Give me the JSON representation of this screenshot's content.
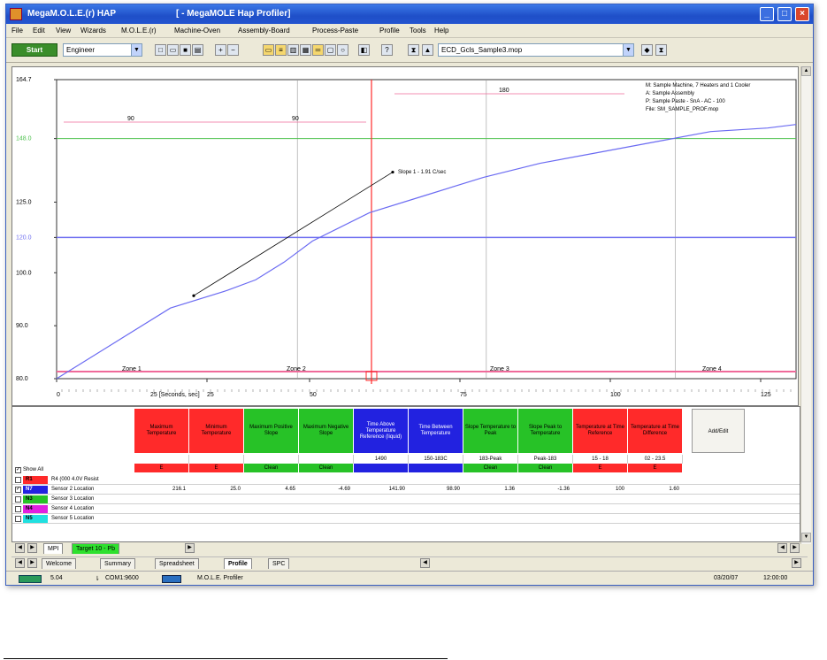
{
  "titlebar": {
    "app_title": "MegaM.O.L.E.(r) HAP",
    "doc_title": "[ - MegaMOLE Hap Profiler]"
  },
  "menu": [
    "File",
    "Edit",
    "View",
    "Wizards",
    "M.O.L.E.(r)",
    "Machine-Oven",
    "Assembly-Board",
    "Process-Paste",
    "Profile",
    "Tools",
    "Help"
  ],
  "toolbar": {
    "start_label": "Start",
    "profile_type": "Engineer",
    "file_name": "ECD_Gcls_Sample3.mop"
  },
  "chart": {
    "yticks": [
      "164.7",
      "148.0",
      "125.0",
      "120.0",
      "100.0",
      "90.0",
      "80.0"
    ],
    "xticks": [
      "0",
      "25",
      "50",
      "75",
      "100",
      "125"
    ],
    "xlabel": "25 [Seconds, sec]",
    "zones": [
      "Zone 1",
      "Zone 2",
      "Zone 3",
      "Zone 4"
    ],
    "span_labels": [
      "90",
      "90",
      "180"
    ],
    "legend": [
      "M: Sample Machine, 7 Heaters and 1 Cooler",
      "A: Sample Assembly",
      "P: Sample Paste - SnA - AC - 100",
      "File: SM_SAMPLE_PROF.mop"
    ],
    "cursor_label": "Slope 1 - 1.91 C/sec",
    "colors": {
      "profile": "#6b6bf2",
      "green": "#4fc24f",
      "blue": "#7070f0",
      "pink": "#ef6a9a",
      "red": "#ff2a2a",
      "black": "#000000"
    }
  },
  "chart_data": {
    "type": "line",
    "title": "",
    "xlabel": "25 [Seconds, sec]",
    "ylabel": "",
    "xlim": [
      0,
      130
    ],
    "ylim": [
      80,
      164.7
    ],
    "series": [
      {
        "x": [
          0,
          10,
          20,
          30,
          35,
          40,
          45,
          55,
          65,
          75,
          85,
          95,
          105,
          115,
          125,
          130
        ],
        "y": [
          80,
          90,
          100,
          105,
          108,
          113,
          119,
          127,
          132,
          137,
          141,
          144,
          147,
          150,
          151,
          152
        ]
      }
    ],
    "reference_lines": [
      148,
      120,
      80
    ]
  },
  "table": {
    "headers": [
      "Maximum Temperature",
      "Minimum Temperature",
      "Maximum Positive Slope",
      "Maximum Negative Slope",
      "Time Above Temperature Reference (liquid)",
      "Time Between Temperature",
      "Slope Temperature to Peak",
      "Slope Peak to Temperature",
      "Temperature at Time Reference",
      "Temperature at Time Difference"
    ],
    "header_colors": [
      "#ff2a2a",
      "#ff2a2a",
      "#27c227",
      "#27c227",
      "#2222e0",
      "#2222e0",
      "#27c227",
      "#27c227",
      "#ff2a2a",
      "#ff2a2a"
    ],
    "specs": [
      "",
      "",
      "",
      "",
      "1490",
      "150-183C",
      "183-Peak",
      "Peak-183",
      "15 - 18",
      "02 - 23.5"
    ],
    "status": [
      "E",
      "E",
      "Clean",
      "Clean",
      "",
      "",
      "Clean",
      "Clean",
      "E",
      "E"
    ],
    "add_edit": "Add/Edit",
    "show_all": "Show All",
    "rows": [
      {
        "tag": "R1",
        "tag_color": "#ff2a2a",
        "label": "R4 (000 4.0V Resist",
        "values": [
          "",
          "",
          "",
          "",
          "",
          "",
          "",
          "",
          "",
          ""
        ]
      },
      {
        "tag": "N7",
        "tag_color": "#2222e0",
        "label": "Sensor 2 Location",
        "values": [
          "216.1",
          "25.0",
          "4.65",
          "-4.69",
          "141.90",
          "98.90",
          "1.36",
          "-1.36",
          "100",
          "1.60"
        ]
      },
      {
        "tag": "N3",
        "tag_color": "#27c227",
        "label": "Sensor 3 Location",
        "values": [
          "",
          "",
          "",
          "",
          "",
          "",
          "",
          "",
          "",
          ""
        ]
      },
      {
        "tag": "N4",
        "tag_color": "#e020e0",
        "label": "Sensor 4 Location",
        "values": [
          "",
          "",
          "",
          "",
          "",
          "",
          "",
          "",
          "",
          ""
        ]
      },
      {
        "tag": "N5",
        "tag_color": "#20e0e0",
        "label": "Sensor 5 Location",
        "values": [
          "",
          "",
          "",
          "",
          "",
          "",
          "",
          "",
          "",
          ""
        ]
      }
    ]
  },
  "tabs1": [
    "MPI",
    "Target 10 - Pb"
  ],
  "tabs2": [
    "Welcome",
    "Summary",
    "Spreadsheet",
    "Profile",
    "SPC"
  ],
  "statusbar": {
    "value": "5.04",
    "com": "COM1:9600",
    "app": "M.O.L.E. Profiler",
    "date": "03/20/07",
    "time": "12:00:00"
  }
}
